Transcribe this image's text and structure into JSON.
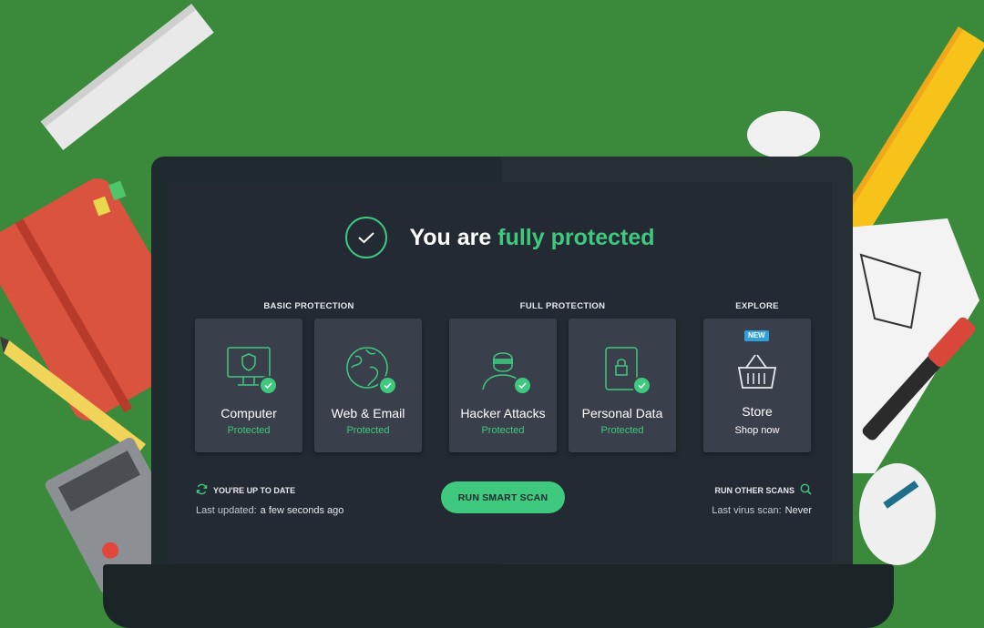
{
  "hero": {
    "title_prefix": "You are ",
    "title_highlight": "fully protected"
  },
  "sections": {
    "basic": "BASIC PROTECTION",
    "full": "FULL PROTECTION",
    "explore": "EXPLORE"
  },
  "tiles": [
    {
      "title": "Computer",
      "status": "Protected",
      "icon": "monitor-shield-icon"
    },
    {
      "title": "Web & Email",
      "status": "Protected",
      "icon": "globe-icon"
    },
    {
      "title": "Hacker Attacks",
      "status": "Protected",
      "icon": "hacker-icon"
    },
    {
      "title": "Personal Data",
      "status": "Protected",
      "icon": "lock-icon"
    },
    {
      "title": "Store",
      "status": "Shop now",
      "badge": "NEW",
      "icon": "basket-icon"
    }
  ],
  "update": {
    "heading": "YOU'RE UP TO DATE",
    "label": "Last updated:",
    "value": "a few seconds ago"
  },
  "scan_button": "RUN SMART SCAN",
  "other_scans": {
    "heading": "RUN OTHER SCANS",
    "label": "Last virus scan:",
    "value": "Never"
  },
  "colors": {
    "accent": "#3ec97e",
    "background": "#3b8a3c",
    "screen": "#242a33",
    "tile": "#3a3f4c",
    "new_badge": "#2fa0d9"
  }
}
